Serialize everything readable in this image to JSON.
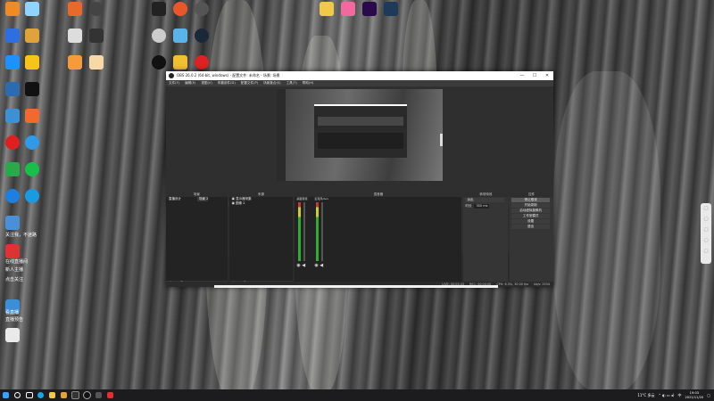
{
  "desktop": {
    "icons": [
      {
        "label": "",
        "color": "#f08a24"
      },
      {
        "label": "",
        "color": "#8fd3ff"
      },
      {
        "label": "",
        "color": "#e86a2b"
      },
      {
        "label": "",
        "color": "#3a3a3a"
      },
      {
        "label": "",
        "color": "#2a2a2a"
      },
      {
        "label": "",
        "color": "#c8c8c8"
      },
      {
        "label": "",
        "color": "#e58b2a"
      },
      {
        "label": "",
        "color": "#e0a33b"
      },
      {
        "label": "",
        "color": "#f59b3a"
      },
      {
        "label": "",
        "color": "#ffffff"
      }
    ],
    "notes": [
      "关注我，不迷路",
      "在线直播间",
      "新人主播",
      "点击关注",
      "看直播",
      "直播预告"
    ]
  },
  "obs": {
    "title": "OBS 26.0.2 (64-bit, windows) - 配置文件: 未命名 - 场景: 场景",
    "window_buttons": [
      "—",
      "☐",
      "✕"
    ],
    "menu": [
      "文件(F)",
      "编辑(E)",
      "视图(V)",
      "停靠部件(D)",
      "配置文件(P)",
      "场景集合(S)",
      "工具(T)",
      "帮助(H)"
    ],
    "scene_bar": {
      "label": "未选择源",
      "props": "属性",
      "filters": "滤镜"
    },
    "docks": {
      "scenes": {
        "title": "场景",
        "items": [
          "直播设计",
          "场景 2"
        ]
      },
      "sources": {
        "title": "来源",
        "items": [
          "显示器采集",
          "图像 2"
        ]
      },
      "mixer": {
        "title": "混音器",
        "channels": [
          "桌面音频",
          "麦克风/Aux"
        ]
      },
      "transitions": {
        "title": "转场特效",
        "type": "淡出",
        "duration_label": "时长",
        "duration": "300 ms"
      },
      "controls": {
        "title": "控件",
        "buttons": [
          "停止推流",
          "开始录制",
          "启动虚拟摄像机",
          "工作室模式",
          "设置",
          "退出"
        ]
      }
    },
    "status": {
      "live": "LIVE: 00:03:43",
      "rec": "REC: 00:00:00",
      "cpu": "CPU: 6.3%, 30.00 fps",
      "kbps": "kb/s: 2534"
    },
    "footer_icons": "+ — ⚙ ∧ ∨"
  },
  "taskbar": {
    "weather": "11°C 多云",
    "lang": "中",
    "time": "19:03",
    "date": "2021/11/20"
  },
  "colors": {
    "accent_green": "#3a3",
    "meter_red": "#c33",
    "titlebar": "#ffffff",
    "obs_bg": "#2b2b2b"
  }
}
